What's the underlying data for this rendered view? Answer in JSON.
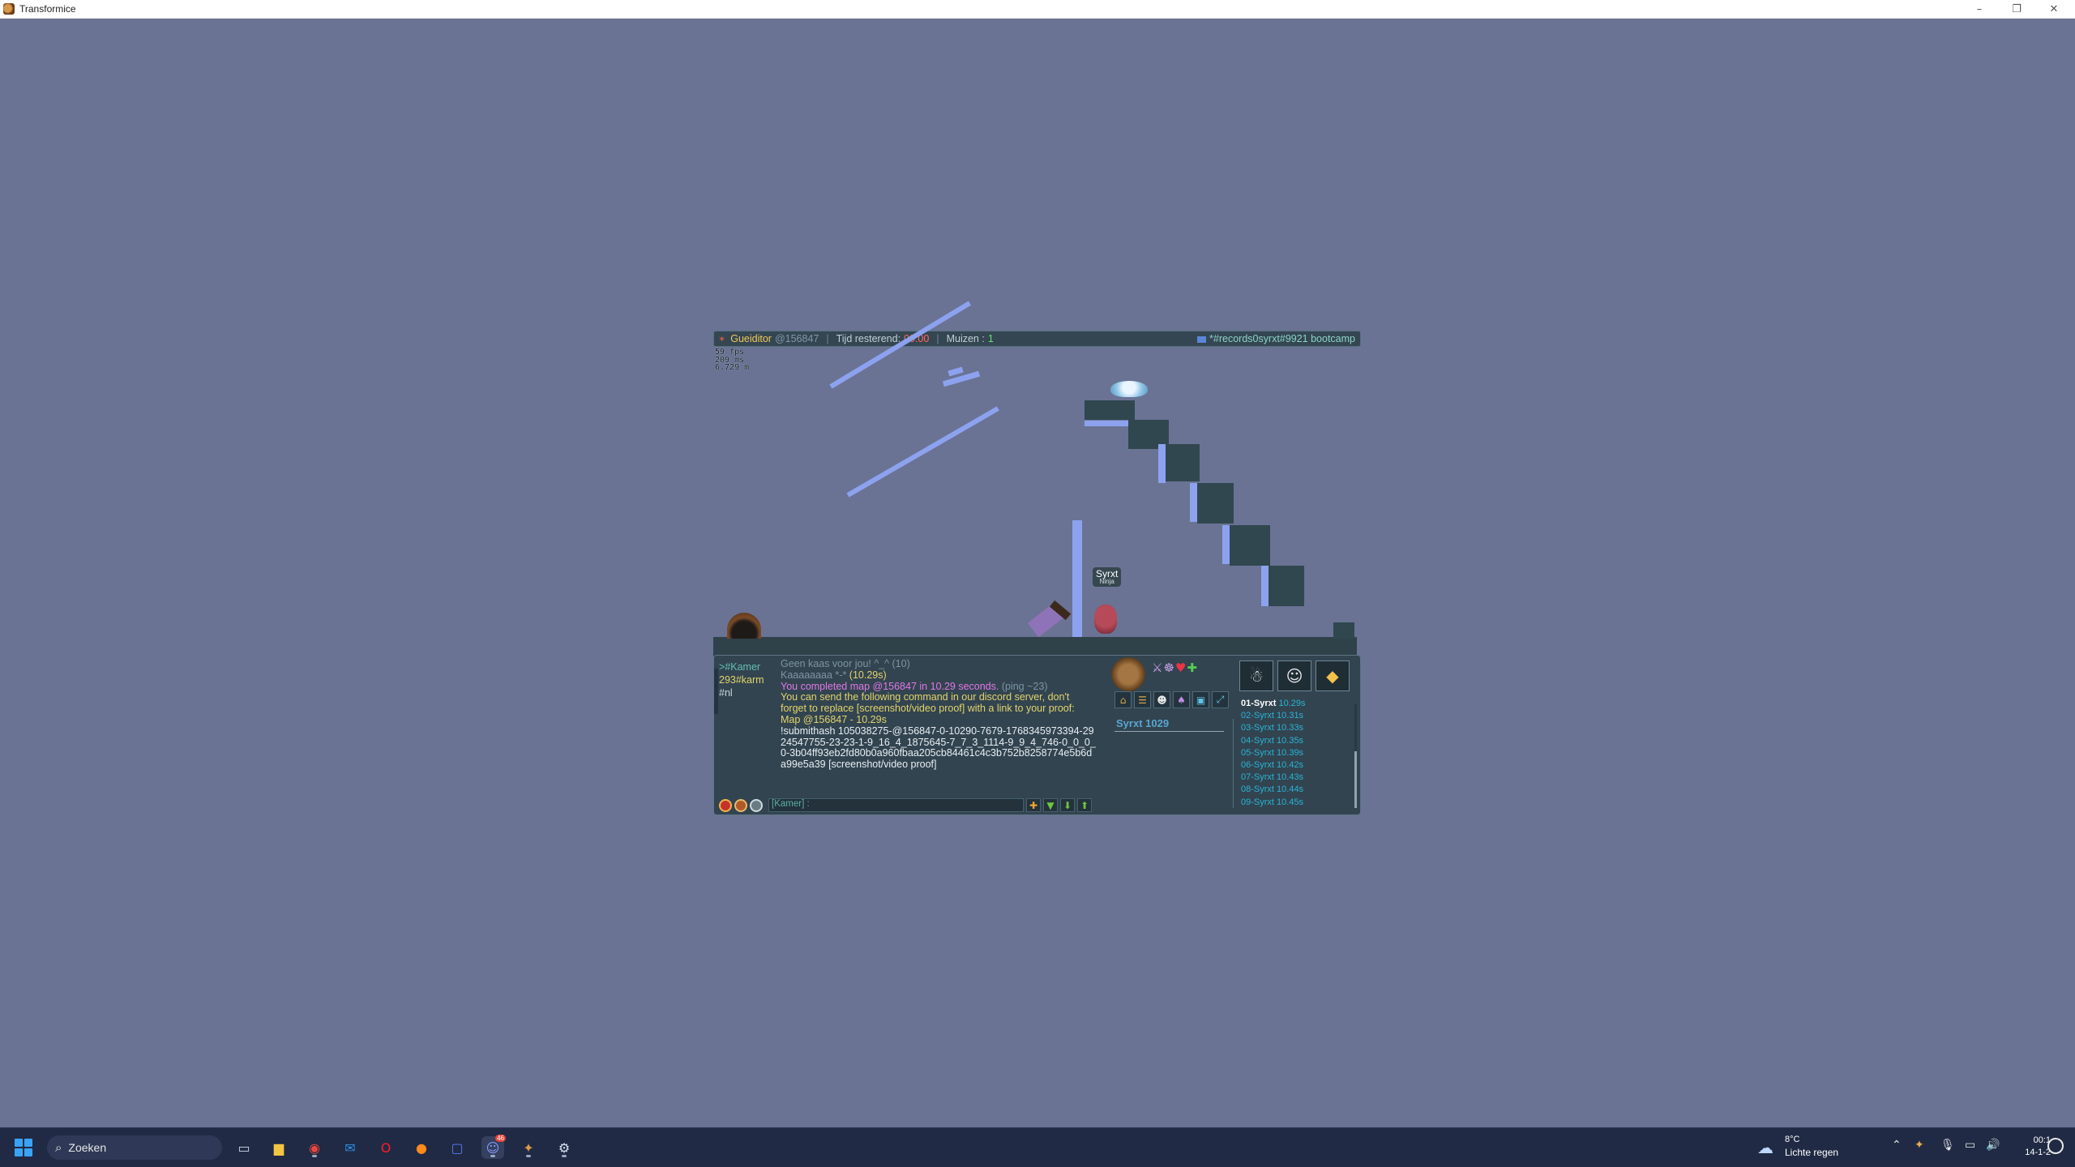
{
  "window": {
    "title": "Transformice",
    "minimize": "–",
    "restore": "❐",
    "close": "✕"
  },
  "topbar": {
    "author": "Gueiditor",
    "map_code": "@156847",
    "time_label": "Tijd resterend:",
    "time_value": "00:00",
    "mice_label": "Muizen :",
    "mice_value": "1",
    "room": "*#records0syrxt#9921 bootcamp"
  },
  "stats": [
    "59 fps",
    "209 ms",
    "6.729 m"
  ],
  "player_tag": {
    "name": "Syrxt",
    "title": "Ninja"
  },
  "chat": {
    "channels": [
      {
        "label": ">#Kamer",
        "color": "#63bfb3"
      },
      {
        "label": "293#karm",
        "color": "#e3d36b"
      },
      {
        "label": "#nl",
        "color": "#c9d6de"
      }
    ],
    "messages": [
      {
        "text": "Geen kaas voor jou! ^_^ (10)",
        "color": "dim"
      },
      {
        "text": "Kaaaaaaaa *-* ",
        "extra": "(10.29s)",
        "color": "dim"
      },
      {
        "text": "You completed map @156847 in 10.29 seconds. ",
        "extra": "(ping ~23)",
        "color": "pink"
      },
      {
        "text": "You can send the following command in our discord server, don't forget to replace [screenshot/video proof] with a link to your proof:",
        "color": "yellow"
      },
      {
        "text": "Map @156847 - 10.29s",
        "color": "yellow"
      },
      {
        "text": "!submithash 105038275-@156847-0-10290-7679-1768345973394-2924547755-23-23-1-9_16_4_1875645-7_7_3_1114-9_9_4_746-0_0_0_0-3b04ff93eb2fd80b0a960fbaa205cb84461c4c3b752b8258774e5b6da99e5a39 [screenshot/video proof]",
        "color": "white"
      }
    ],
    "input_placeholder": "[Kamer] :",
    "input_buttons": [
      "✚",
      "▼",
      "⬇",
      "⬆"
    ]
  },
  "side": {
    "player_name": "Syrxt 1029",
    "leaderboard": [
      {
        "rank": "01-Syrxt",
        "time": "10.29s"
      },
      {
        "rank": "02-Syrxt",
        "time": "10.31s"
      },
      {
        "rank": "03-Syrxt",
        "time": "10.33s"
      },
      {
        "rank": "04-Syrxt",
        "time": "10.35s"
      },
      {
        "rank": "05-Syrxt",
        "time": "10.39s"
      },
      {
        "rank": "06-Syrxt",
        "time": "10.42s"
      },
      {
        "rank": "07-Syrxt",
        "time": "10.43s"
      },
      {
        "rank": "08-Syrxt",
        "time": "10.44s"
      },
      {
        "rank": "09-Syrxt",
        "time": "10.45s"
      }
    ]
  },
  "taskbar": {
    "search_placeholder": "Zoeken",
    "apps": [
      "task-view",
      "file-explorer",
      "chrome",
      "outlook",
      "opera",
      "firefox",
      "teams",
      "discord",
      "transformice",
      "steam"
    ],
    "discord_badge": "46",
    "weather_temp": "8°C",
    "weather_desc": "Lichte regen",
    "time": "00:1",
    "date": "14-1-2"
  },
  "colors": {
    "background": "#6a7394",
    "platform": "#30474f",
    "ice": "#8da2ef"
  }
}
